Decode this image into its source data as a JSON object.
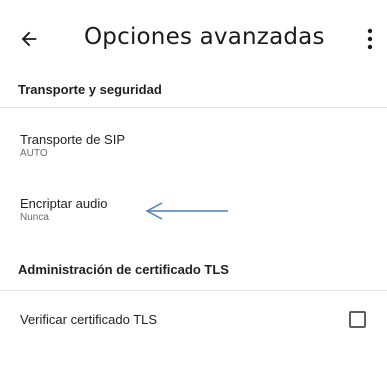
{
  "app_bar": {
    "title": "Opciones avanzadas",
    "back_icon": "arrow-left-icon",
    "menu_icon": "more-vert-icon"
  },
  "sections": [
    {
      "header": "Transporte y seguridad",
      "items": [
        {
          "title": "Transporte de SIP",
          "summary": "AUTO"
        },
        {
          "title": "Encriptar audio",
          "summary": "Nunca"
        }
      ]
    },
    {
      "header": "Administración de certificado TLS",
      "items": [
        {
          "title": "Verificar certificado TLS",
          "checked": false
        }
      ]
    }
  ],
  "annotation": {
    "arrow_color": "#4a7fc1",
    "arrow_icon": "left-arrow-annotation-icon"
  }
}
